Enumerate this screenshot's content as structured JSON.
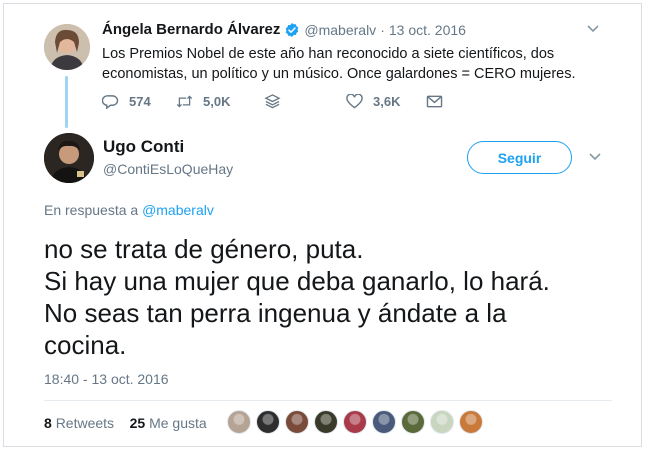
{
  "parent_tweet": {
    "name": "Ángela Bernardo Álvarez",
    "handle": "@maberalv",
    "separator": "·",
    "date": "13 oct. 2016",
    "text": "Los Premios Nobel de este año han reconocido a siete científicos, dos economistas, un político y un músico. Once galardones = CERO mujeres.",
    "actions": {
      "replies": "574",
      "retweets": "5,0K",
      "likes": "3,6K"
    }
  },
  "reply_tweet": {
    "name": "Ugo Conti",
    "handle": "@ContiEsLoQueHay",
    "follow_label": "Seguir",
    "reply_prefix": "En respuesta a",
    "reply_mention": "@maberalv",
    "text_lines": [
      "no se trata de género, puta.",
      "Si hay una mujer que deba ganarlo, lo hará.",
      "No seas tan perra ingenua y ándate a la",
      "cocina."
    ],
    "timestamp": "18:40 - 13 oct. 2016",
    "retweet_count": "8",
    "retweet_label": "Retweets",
    "like_count": "25",
    "like_label": "Me gusta"
  },
  "liker_colors": [
    "#b5a394",
    "#2e2e2e",
    "#7a4a3a",
    "#3a3a2a",
    "#a83a4a",
    "#4a5a7a",
    "#5a6a3a",
    "#c8d6c0",
    "#c97a3a"
  ],
  "colors": {
    "accent": "#1da1f2",
    "verified": "#1da1f2",
    "thread": "#9fd4f3",
    "muted": "#657786"
  }
}
